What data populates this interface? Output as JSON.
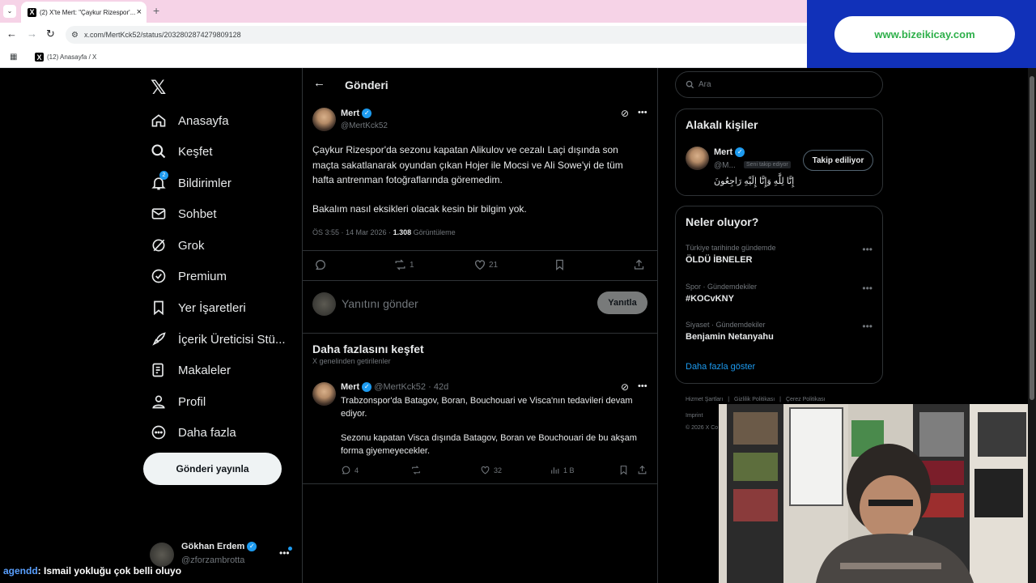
{
  "browser": {
    "tab_title": "(2) X'te Mert: \"Çaykur Rizespor'...",
    "url": "x.com/MertKck52/status/2032802874279809128",
    "bookmark": "(12) Anasayfa / X",
    "promo": "www.bizeikicay.com"
  },
  "nav": {
    "items": [
      "Anasayfa",
      "Keşfet",
      "Bildirimler",
      "Sohbet",
      "Grok",
      "Premium",
      "Yer İşaretleri",
      "İçerik Üreticisi Stü...",
      "Makaleler",
      "Profil",
      "Daha fazla"
    ],
    "notif_badge": "2",
    "post_button": "Gönderi yayınla",
    "account_name": "Gökhan Erdem",
    "account_handle": "@zforzambrotta"
  },
  "header": {
    "title": "Gönderi"
  },
  "tweet": {
    "name": "Mert",
    "handle": "@MertKck52",
    "text1": "Çaykur Rizespor'da sezonu kapatan Alikulov ve cezalı Laçi dışında son maçta sakatlanarak oyundan çıkan Hojer ile Mocsi ve Ali Sowe'yi de tüm hafta antrenman fotoğraflarında göremedim.",
    "text2": "Bakalım nasıl eksikleri olacak kesin bir bilgim yok.",
    "time": "ÖS 3:55 · 14 Mar 2026 ·",
    "views": "1.308",
    "views_label": "Görüntüleme",
    "retweets": "1",
    "likes": "21"
  },
  "reply": {
    "placeholder": "Yanıtını gönder",
    "button": "Yanıtla"
  },
  "discover": {
    "title": "Daha fazlasını keşfet",
    "subtitle": "X genelinden getirilenler",
    "tweet": {
      "name": "Mert",
      "handle": "@MertKck52",
      "age": "· 42d",
      "text1": "Trabzonspor'da Batagov, Boran, Bouchouari ve Visca'nın tedavileri devam ediyor.",
      "text2": "Sezonu kapatan Visca dışında Batagov, Boran ve Bouchouari de bu akşam forma giyemeyecekler.",
      "replies": "4",
      "likes": "32",
      "views": "1 B"
    }
  },
  "search": {
    "placeholder": "Ara"
  },
  "related": {
    "title": "Alakalı kişiler",
    "name": "Mert",
    "handle": "@M...",
    "follows_you": "Seni takip ediyor",
    "bio": "إِنَّا لِلَّهِ وَإِنَّا إِلَيْهِ رَاجِعُونَ",
    "button": "Takip ediliyor"
  },
  "trends": {
    "title": "Neler oluyor?",
    "items": [
      {
        "context": "Türkiye tarihinde gündemde",
        "name": "ÖLDÜ İBNELER"
      },
      {
        "context": "Spor · Gündemdekiler",
        "name": "#KOCvKNY"
      },
      {
        "context": "Siyaset · Gündemdekiler",
        "name": "Benjamin Netanyahu"
      }
    ],
    "show_more": "Daha fazla göster"
  },
  "footer": {
    "links": [
      "Hizmet Şartları",
      "Gizlilik Politikası",
      "Çerez Politikası"
    ],
    "imprint": "Imprint",
    "copyright": "© 2026 X Co"
  },
  "chat": {
    "user": "agendd",
    "message": ": Ismail yokluğu çok belli oluyo"
  },
  "colors": {
    "accent": "#1d9bf0",
    "background": "#000000",
    "promo": "#1131b9"
  }
}
